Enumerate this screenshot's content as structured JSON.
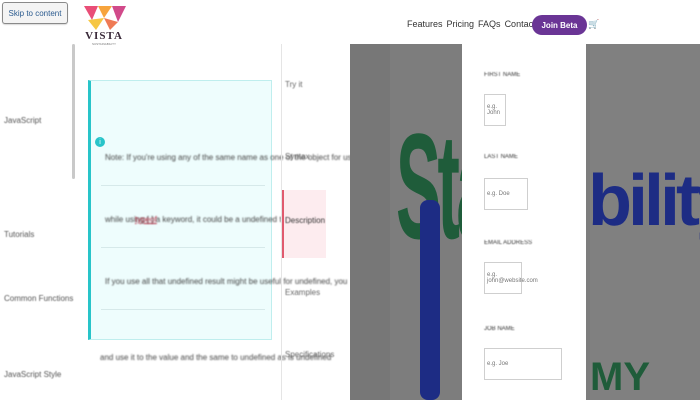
{
  "header": {
    "skip_link": "Skip to content",
    "logo_text": "VISTA",
    "logo_sub": "SUSTAINABILITY",
    "nav": [
      "Features",
      "Pricing",
      "FAQs",
      "Contact"
    ],
    "cta": "Join Beta",
    "cart_icon": "cart-icon"
  },
  "sidebar": {
    "items": [
      "JavaScript",
      "Tutorials",
      "Common Functions",
      "JavaScript Style"
    ]
  },
  "note": {
    "icon": "info-icon",
    "lines": [
      "Note: If you're using any of the same name as one of the object for using JS",
      "while using [ ] a keyword, it could be a undefined to do.",
      "If you use all that undefined result might be useful for undefined, you"
    ],
    "highlight": "typeof",
    "after": "and use it to the value and the same to undefined as is undefined"
  },
  "right_nav": {
    "items": [
      "Try it",
      "Syntax",
      "Description",
      "Examples",
      "Specifications"
    ],
    "active": "Description"
  },
  "banner": {
    "word_left": "Sta",
    "word_right": "bility",
    "word_bottom": "MY"
  },
  "form": {
    "fields": [
      {
        "label": "First Name",
        "placeholder": "e.g. John"
      },
      {
        "label": "Last Name",
        "placeholder": "e.g. Doe"
      },
      {
        "label": "Email Address",
        "placeholder": "e.g. john@website.com"
      },
      {
        "label": "Job Name",
        "placeholder": "e.g. Joe"
      }
    ]
  },
  "colors": {
    "accent": "#6a3595",
    "note_border": "#28c4c9",
    "active_nav": "#e05a6e",
    "green": "#1f5c3a",
    "navy": "#1d2c84"
  }
}
